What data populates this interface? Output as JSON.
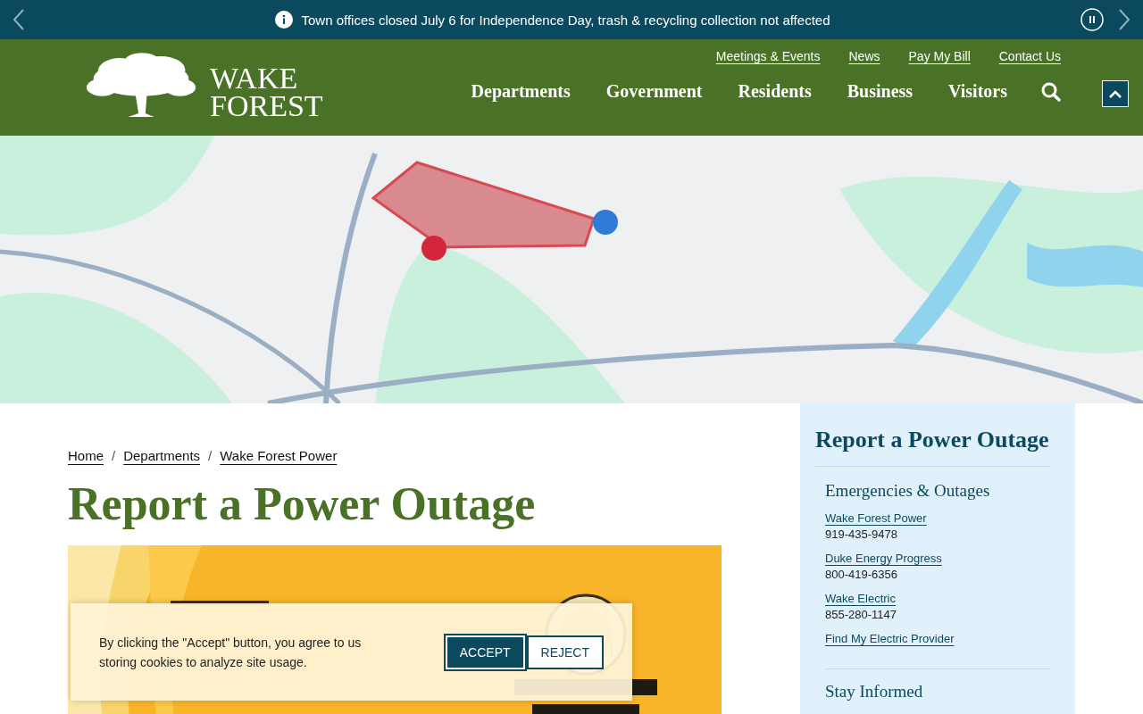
{
  "alert_bar": {
    "text": "Town offices closed July 6 for Independence Day, trash & recycling collection not affected"
  },
  "header": {
    "logo_lines": [
      "WAKE",
      "FOREST"
    ],
    "utility_links": [
      "Meetings & Events",
      "News",
      "Pay My Bill",
      "Contact Us"
    ],
    "nav": [
      "Departments",
      "Government",
      "Residents",
      "Business",
      "Visitors"
    ]
  },
  "breadcrumbs": {
    "separator": "/",
    "items": [
      "Home",
      "Departments",
      "Wake Forest Power"
    ]
  },
  "page_title": "Report a Power Outage",
  "cookie_notice": {
    "text": "By clicking the \"Accept\" button, you agree to us storing cookies to analyze site usage.",
    "buttons": [
      {
        "label": "ACCEPT",
        "kind": "primary"
      },
      {
        "label": "REJECT",
        "kind": "secondary"
      }
    ]
  },
  "sidebar": {
    "title": "Report a Power Outage",
    "sections": [
      {
        "heading": "Emergencies & Outages",
        "items": [
          {
            "link": "Wake Forest Power",
            "phone": "919-435-9478"
          },
          {
            "link": "Duke Energy Progress",
            "phone": "800-419-6356"
          },
          {
            "link": "Wake Electric",
            "phone": "855-280-1147"
          },
          {
            "link": "Find My Electric Provider"
          }
        ]
      },
      {
        "heading": "Stay Informed"
      }
    ]
  }
}
